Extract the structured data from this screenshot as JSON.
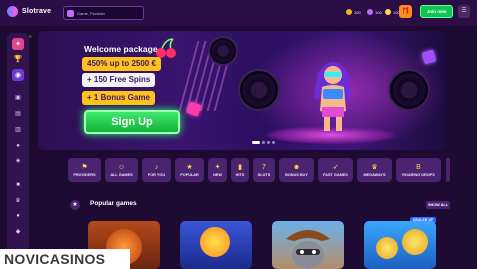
{
  "brand": {
    "name": "Slotrave"
  },
  "search": {
    "placeholder": "Game, Provider"
  },
  "header": {
    "balances": [
      {
        "icon": "coin-icon",
        "value": "100",
        "color": "#f5b21c"
      },
      {
        "icon": "gem-icon",
        "value": "100",
        "color": "#b46cff"
      },
      {
        "icon": "star-coin-icon",
        "value": "100",
        "color": "#ffd54a"
      }
    ],
    "join_label": "Join now"
  },
  "banner": {
    "welcome": "Welcome package",
    "offer_1": "450% up to 2500 €",
    "offer_2": "+ 150 Free Spins",
    "offer_3": "+ 1 Bonus Game",
    "cta": "Sign Up"
  },
  "categories": [
    {
      "label": "PROVIDERS",
      "icon": "flag-icon"
    },
    {
      "label": "ALL GAMES",
      "icon": "smile-icon"
    },
    {
      "label": "FOR YOU",
      "icon": "music-icon"
    },
    {
      "label": "POPULAR",
      "icon": "star-icon"
    },
    {
      "label": "NEW",
      "icon": "sparkle-icon"
    },
    {
      "label": "HITS",
      "icon": "bars-icon"
    },
    {
      "label": "SLOTS",
      "icon": "slot-icon"
    },
    {
      "label": "BONUS BUY",
      "icon": "face-icon"
    },
    {
      "label": "FAST GAMES",
      "icon": "rocket-icon"
    },
    {
      "label": "MEGAWAYS",
      "icon": "crown-icon"
    },
    {
      "label": "ROARING DROPS",
      "icon": "b-icon"
    }
  ],
  "popular": {
    "title": "Popular games",
    "show_all": "SHOW ALL",
    "badge": "DEALER XP"
  },
  "watermark": "NOVICASINOS"
}
